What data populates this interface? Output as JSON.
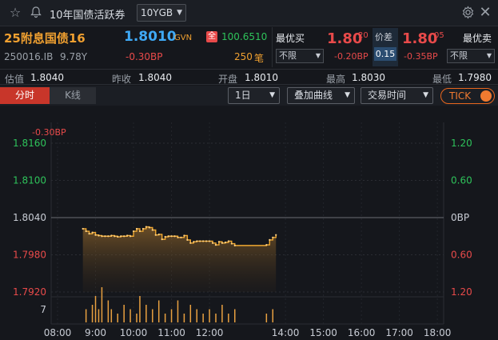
{
  "titlebar": {
    "title": "10年国债活跃券",
    "selector_value": "10YGB"
  },
  "quote": {
    "name": "25附息国债16",
    "price": "1.8010",
    "price_type": "GVN",
    "full_badge": "全",
    "full_price": "100.6510",
    "best_buy_label": "最优买",
    "best_buy_price": "1.80",
    "best_buy_sup": "20",
    "spread_label": "价差",
    "spread_value": "0.15",
    "best_sell_price": "1.80",
    "best_sell_sup": "05",
    "best_sell_label": "最优卖",
    "code": "250016.IB",
    "tenor": "9.78Y",
    "change": "-0.30BP",
    "volume": "250",
    "volume_unit": "笔",
    "buy_limit": "不限",
    "buy_change": "-0.20BP",
    "sell_change": "-0.35BP",
    "sell_limit": "不限"
  },
  "stats": {
    "estimate_label": "估值",
    "estimate": "1.8040",
    "prev_label": "昨收",
    "prev": "1.8040",
    "open_label": "开盘",
    "open": "1.8010",
    "high_label": "最高",
    "high": "1.8030",
    "low_label": "最低",
    "low": "1.7980"
  },
  "toolbar": {
    "tab_intraday": "分时",
    "tab_kline": "K线",
    "period": "1日",
    "overlay": "叠加曲线",
    "trade_time": "交易时间",
    "tick": "TICK"
  },
  "colors": {
    "up": "#e84a4a",
    "down": "#2ec25a",
    "price_line": "#f0a830",
    "accent": "#3fa9f5",
    "tick_orange": "#f07a30"
  },
  "chart_data": {
    "type": "line",
    "change_label": "-0.30BP",
    "y_left_ticks": [
      "1.8160",
      "1.8100",
      "1.8040",
      "1.7980",
      "1.7920"
    ],
    "y_right_ticks": [
      "1.20",
      "0.60",
      "0BP",
      "0.60",
      "1.20"
    ],
    "x_ticks": [
      "08:00",
      "9:00",
      "10:00",
      "11:00",
      "12:00",
      "14:00",
      "15:00",
      "16:00",
      "17:00",
      "18:00"
    ],
    "ylim": [
      1.792,
      1.816
    ],
    "reference": 1.804,
    "volume_tick": "7",
    "volume_max": 8,
    "series": [
      {
        "x": [
          "08:40",
          "08:45",
          "08:50",
          "08:55",
          "09:00",
          "09:05",
          "09:10",
          "09:15",
          "09:20",
          "09:25",
          "09:30",
          "09:35",
          "09:40",
          "09:45",
          "09:50",
          "09:55",
          "10:00",
          "10:05",
          "10:10",
          "10:15",
          "10:20",
          "10:25",
          "10:30",
          "10:35",
          "10:40",
          "10:45",
          "10:50",
          "10:55",
          "11:00",
          "11:05",
          "11:10",
          "11:15",
          "11:20",
          "11:25",
          "11:30",
          "11:35",
          "11:40",
          "11:45",
          "11:50",
          "11:55",
          "12:00",
          "12:05",
          "12:10",
          "12:15",
          "12:20",
          "12:25",
          "12:30",
          "12:35",
          "12:40",
          "13:30",
          "13:35",
          "13:40",
          "13:45"
        ],
        "values": [
          1.8022,
          1.8018,
          1.8014,
          1.8016,
          1.8012,
          1.8011,
          1.801,
          1.801,
          1.801,
          1.8011,
          1.801,
          1.8009,
          1.801,
          1.801,
          1.8011,
          1.801,
          1.8018,
          1.8022,
          1.8018,
          1.8022,
          1.8025,
          1.8024,
          1.802,
          1.8012,
          1.8013,
          1.8005,
          1.8009,
          1.801,
          1.801,
          1.801,
          1.8008,
          1.8008,
          1.8011,
          1.8004,
          1.7999,
          1.8001,
          1.8002,
          1.8002,
          1.8002,
          1.8002,
          1.8002,
          1.7999,
          1.7996,
          1.8001,
          1.7999,
          1.8,
          1.8002,
          1.7998,
          1.7995,
          1.7996,
          1.8004,
          1.8008,
          1.8012
        ]
      }
    ],
    "volume": {
      "x": [
        "08:45",
        "08:55",
        "09:00",
        "09:05",
        "09:10",
        "09:20",
        "09:25",
        "09:35",
        "09:45",
        "09:55",
        "10:05",
        "10:10",
        "10:20",
        "10:30",
        "10:40",
        "10:50",
        "11:00",
        "11:10",
        "11:20",
        "11:30",
        "11:40",
        "11:50",
        "12:00",
        "12:10",
        "12:20",
        "12:30",
        "12:40",
        "13:30",
        "13:40"
      ],
      "values": [
        3,
        4,
        6,
        3,
        8,
        5,
        3,
        2,
        4,
        3,
        2,
        6,
        4,
        3,
        5,
        2,
        3,
        5,
        2,
        4,
        3,
        2,
        3,
        2,
        4,
        2,
        3,
        2,
        3
      ]
    }
  }
}
